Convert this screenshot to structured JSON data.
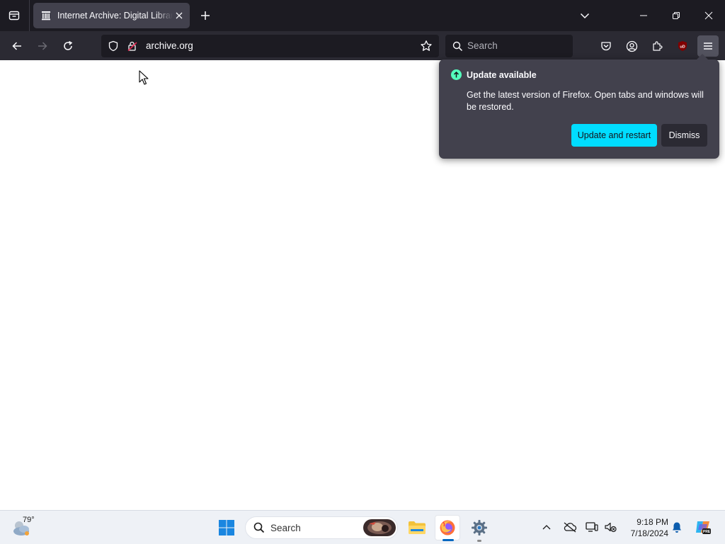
{
  "browser": {
    "tabs": [
      {
        "title": "Internet Archive: Digital Library of Free & Borrowable Books",
        "favicon": "archive-building-icon",
        "active": true
      }
    ],
    "url": "archive.org",
    "search_placeholder": "Search",
    "colors": {
      "tabstrip": "#1c1b22",
      "navbar": "#2b2a33",
      "accent_button": "#00ddff",
      "update_icon": "#54ffbd",
      "popup_bg": "#42414d"
    }
  },
  "update_popup": {
    "title": "Update available",
    "description": "Get the latest version of Firefox. Open tabs and windows will be restored.",
    "primary_button": "Update and restart",
    "secondary_button": "Dismiss"
  },
  "taskbar": {
    "weather_temp": "79°",
    "search_label": "Search",
    "time": "9:18 PM",
    "date": "7/18/2024"
  }
}
